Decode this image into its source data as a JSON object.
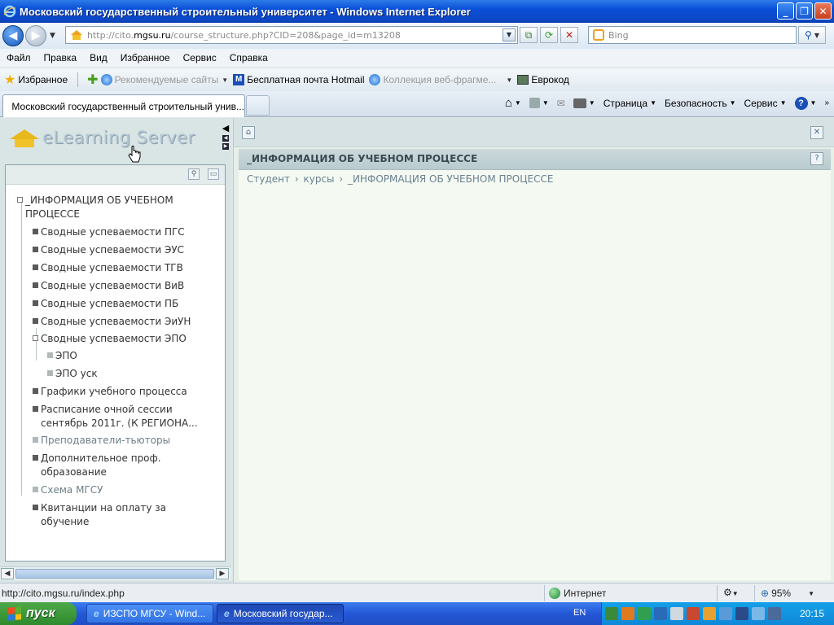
{
  "window": {
    "title": "Московский государственный строительный университет - Windows Internet Explorer"
  },
  "nav": {
    "url_prefix": "http://cito.",
    "url_domain": "mgsu.ru",
    "url_rest": "/course_structure.php?CID=208&page_id=m13208",
    "search_placeholder": "Bing"
  },
  "menu": [
    "Файл",
    "Правка",
    "Вид",
    "Избранное",
    "Сервис",
    "Справка"
  ],
  "favorites": {
    "label": "Избранное",
    "links": [
      {
        "label": "Рекомендуемые сайты",
        "dim": true
      },
      {
        "label": "Бесплатная почта Hotmail",
        "dim": false
      },
      {
        "label": "Коллекция веб-фрагме...",
        "dim": true
      },
      {
        "label": "Еврокод",
        "dim": false
      }
    ]
  },
  "tab": {
    "title": "Московский государственный строительный унив..."
  },
  "commands": {
    "page": "Страница",
    "security": "Безопасность",
    "tools": "Сервис"
  },
  "site": {
    "logo_text": "eLearning Server",
    "tree": {
      "root": "_ИНФОРМАЦИЯ ОБ УЧЕБНОМ ПРОЦЕССЕ",
      "items": [
        {
          "label": "Сводные успеваемости ПГС"
        },
        {
          "label": "Сводные успеваемости ЭУС"
        },
        {
          "label": "Сводные успеваемости ТГВ"
        },
        {
          "label": "Сводные успеваемости ВиВ"
        },
        {
          "label": "Сводные успеваемости ПБ"
        },
        {
          "label": "Сводные успеваемости ЭиУН"
        },
        {
          "label": "Сводные успеваемости ЭПО"
        },
        {
          "label": "ЭПО"
        },
        {
          "label": "ЭПО уск"
        },
        {
          "label": "Графики учебного процесса"
        },
        {
          "label": "Расписание очной сессии сентябрь 2011г. (К РЕГИОНА..."
        },
        {
          "label": "Преподаватели-тьюторы"
        },
        {
          "label": "Дополнительное проф. образование"
        },
        {
          "label": "Схема МГСУ"
        },
        {
          "label": "Квитанции на оплату за обучение"
        }
      ]
    },
    "section_title": "_ИНФОРМАЦИЯ ОБ УЧЕБНОМ ПРОЦЕССЕ",
    "breadcrumb": {
      "items": [
        "Студент",
        "курсы",
        "_ИНФОРМАЦИЯ ОБ УЧЕБНОМ ПРОЦЕССЕ"
      ],
      "separator": "›"
    }
  },
  "status": {
    "url": "http://cito.mgsu.ru/index.php",
    "zone": "Интернет",
    "zoom": "95%"
  },
  "taskbar": {
    "start_label": "пуск",
    "tasks": [
      {
        "label": "ИЗСПО МГСУ - Wind..."
      },
      {
        "label": "Московский государ..."
      }
    ],
    "lang": "EN",
    "time": "20:15"
  },
  "colors": {
    "title_bar": "#0a4fd8",
    "page_bg": "#dfe8e8",
    "tree_bullet": "#5a5a5a",
    "taskbar": "#2457d6",
    "start": "#3c9a3a"
  }
}
